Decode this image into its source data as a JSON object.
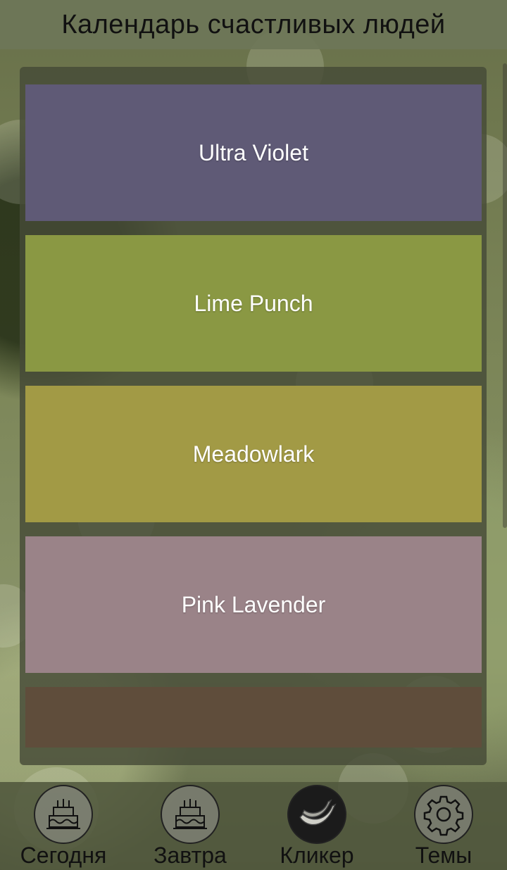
{
  "header": {
    "title": "Календарь счастливых людей"
  },
  "themes": [
    {
      "label": "Ultra Violet",
      "color": "#5f5a76"
    },
    {
      "label": "Lime Punch",
      "color": "#8a9843"
    },
    {
      "label": "Meadowlark",
      "color": "#a29a45"
    },
    {
      "label": "Pink Lavender",
      "color": "#9a8388"
    },
    {
      "label": "",
      "color": "#5f4d3b"
    }
  ],
  "nav": {
    "items": [
      {
        "label": "Сегодня",
        "icon": "birthday-cake-icon"
      },
      {
        "label": "Завтра",
        "icon": "birthday-cake-icon"
      },
      {
        "label": "Кликер",
        "icon": "banana-icon"
      },
      {
        "label": "Темы",
        "icon": "gear-icon"
      }
    ]
  }
}
